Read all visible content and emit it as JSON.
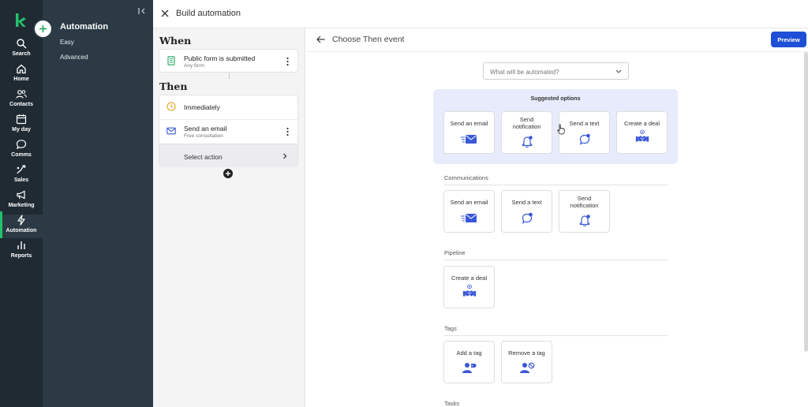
{
  "app": {
    "colors": {
      "rail": "#1f2a33",
      "subnav": "#2b3a44",
      "brand_green": "#23c16b",
      "accent_blue": "#1f4fd6",
      "icon_blue": "#3b58d8",
      "suggest_bg": "#e8ebfb"
    }
  },
  "rail": {
    "logo_icon": "brand-k-logo",
    "items": [
      {
        "label": "Search",
        "icon": "search-icon"
      },
      {
        "label": "Home",
        "icon": "home-icon"
      },
      {
        "label": "Contacts",
        "icon": "contacts-icon"
      },
      {
        "label": "My day",
        "icon": "calendar-icon"
      },
      {
        "label": "Comms",
        "icon": "chat-icon"
      },
      {
        "label": "Sales",
        "icon": "sales-icon"
      },
      {
        "label": "Marketing",
        "icon": "megaphone-icon"
      },
      {
        "label": "Automation",
        "icon": "bolt-icon",
        "active": true
      },
      {
        "label": "Reports",
        "icon": "bar-chart-icon"
      }
    ]
  },
  "subnav": {
    "title": "Automation",
    "items": [
      {
        "label": "Easy"
      },
      {
        "label": "Advanced"
      }
    ]
  },
  "header": {
    "title": "Build automation"
  },
  "builder": {
    "when_heading": "When",
    "then_heading": "Then",
    "trigger": {
      "title": "Public form is submitted",
      "subtitle": "Any form"
    },
    "steps": [
      {
        "title": "Immediately"
      },
      {
        "title": "Send an email",
        "subtitle": "Free consultation"
      }
    ],
    "select_action": "Select action"
  },
  "main": {
    "title": "Choose Then event",
    "preview_label": "Preview",
    "search_placeholder": "What will be automated?",
    "suggested": {
      "title": "Suggested options",
      "options": [
        {
          "label": "Send an email"
        },
        {
          "label": "Send notification"
        },
        {
          "label": "Send a text"
        },
        {
          "label": "Create a deal"
        }
      ]
    },
    "categories": [
      {
        "name": "Communications",
        "options": [
          {
            "label": "Send an email"
          },
          {
            "label": "Send a text"
          },
          {
            "label": "Send notification"
          }
        ]
      },
      {
        "name": "Pipeline",
        "options": [
          {
            "label": "Create a deal"
          }
        ]
      },
      {
        "name": "Tags",
        "options": [
          {
            "label": "Add a tag"
          },
          {
            "label": "Remove a tag"
          }
        ]
      },
      {
        "name": "Tasks",
        "options": []
      }
    ]
  }
}
